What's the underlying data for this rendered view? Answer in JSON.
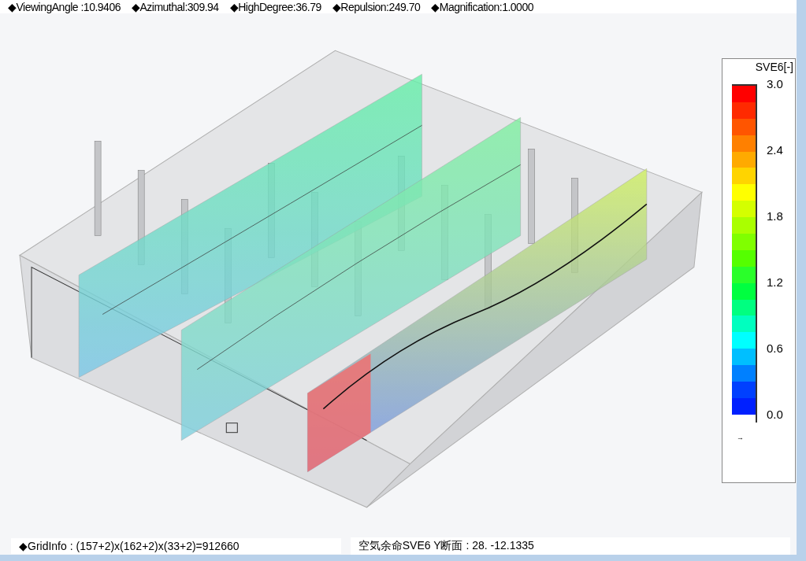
{
  "top_bar": {
    "items": [
      "◆ViewingAngle :10.9406",
      "◆Azimuthal:309.94",
      "◆HighDegree:36.79",
      "◆Repulsion:249.70",
      "◆Magnification:1.0000"
    ]
  },
  "legend": {
    "title": "SVE6[-]",
    "ticks": [
      "3.0",
      "2.4",
      "1.8",
      "1.2",
      "0.6",
      "0.0"
    ],
    "arrow_mark": "→",
    "swatches": [
      {
        "color": "#ff0000"
      },
      {
        "color": "#ff2a00"
      },
      {
        "color": "#ff5500"
      },
      {
        "color": "#ff8000"
      },
      {
        "color": "#ffaa00"
      },
      {
        "color": "#ffd400"
      },
      {
        "color": "#ffff00"
      },
      {
        "color": "#d4ff00"
      },
      {
        "color": "#aaff00"
      },
      {
        "color": "#80ff00"
      },
      {
        "color": "#55ff00"
      },
      {
        "color": "#2aff2a"
      },
      {
        "color": "#00ff40"
      },
      {
        "color": "#00ff80"
      },
      {
        "color": "#00ffbf"
      },
      {
        "color": "#00ffff"
      },
      {
        "color": "#00bfff"
      },
      {
        "color": "#0080ff"
      },
      {
        "color": "#0040ff"
      },
      {
        "color": "#0020ff"
      }
    ]
  },
  "status_bar": {
    "grid_info": "◆GridInfo : (157+2)x(162+2)x(33+2)=912660",
    "section_info": "空気余命SVE6 Y断面 : 28.  -12.1335"
  }
}
